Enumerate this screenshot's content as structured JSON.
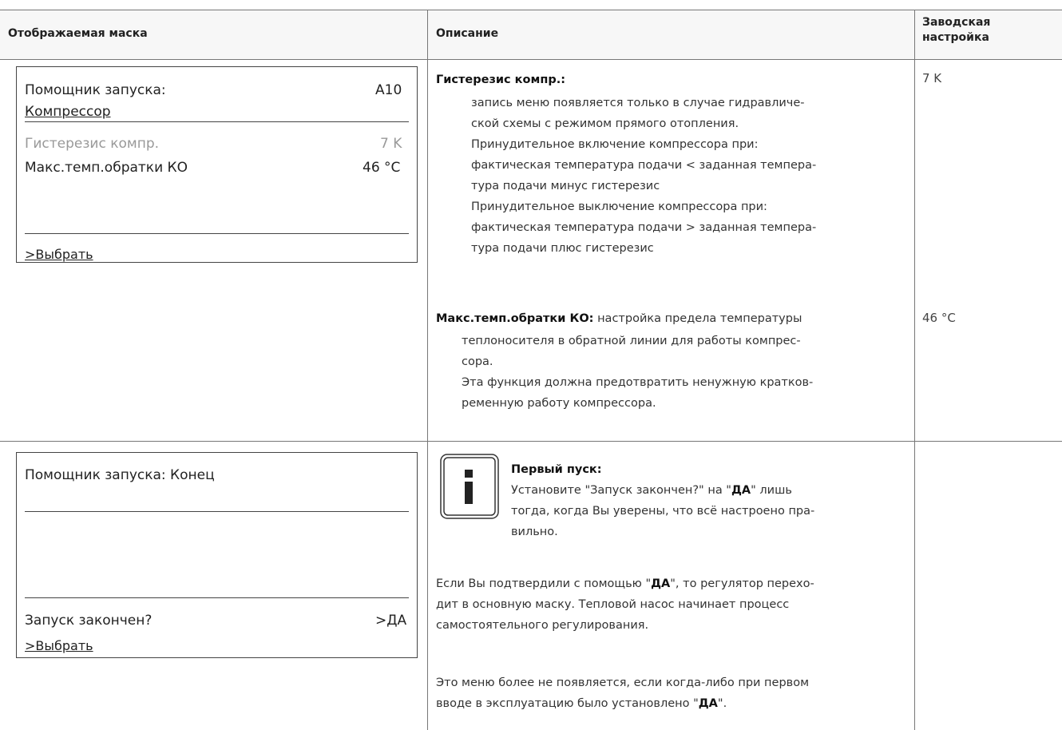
{
  "header": {
    "col1": "Отображаемая маска",
    "col2": "Описание",
    "col3_line1": "Заводская",
    "col3_line2": "настройка"
  },
  "row1": {
    "screen": {
      "title": "Помощник запуска:",
      "code": "A10",
      "subtitle": "Компрессор",
      "item1_label": "Гистерезис компр.",
      "item1_value": "7 K",
      "item2_label": "Макс.темп.обратки КО",
      "item2_value": "46 °C",
      "action": ">Выбрать"
    },
    "desc1": {
      "term": "Гистерезис компр.:",
      "lines": [
        "запись меню появляется только в случае гидравличе-",
        "ской схемы с режимом прямого отопления.",
        "Принудительное включение компрессора при:",
        "фактическая температура подачи < заданная темпера-",
        "тура подачи минус гистерезис",
        "Принудительное выключение компрессора при:",
        "фактическая температура подачи > заданная темпера-",
        "тура подачи плюс гистерезис"
      ]
    },
    "desc2": {
      "term": "Макс.темп.обратки КО:",
      "first_line": " настройка предела температуры",
      "lines": [
        "теплоносителя в обратной линии для работы компрес-",
        "сора.",
        "Эта функция должна предотвратить ненужную кратков-",
        "ременную работу компрессора."
      ]
    },
    "factory1": "7 K",
    "factory2": "46 °C"
  },
  "row2": {
    "screen": {
      "title": "Помощник запуска: Конец",
      "question": "Запуск закончен?",
      "answer": ">ДА",
      "action": ">Выбрать"
    },
    "note": {
      "icon": "info-icon",
      "title": "Первый пуск:",
      "l1_a": "Установите \"Запуск закончен?\" на \"",
      "l1_b": "ДА",
      "l1_c": "\" лишь",
      "l2": "тогда, когда Вы уверены, что всё настроено пра-",
      "l3": "вильно."
    },
    "para1": {
      "l1_a": "Если Вы подтвердили с помощью \"",
      "l1_b": "ДА",
      "l1_c": "\", то регулятор перехо-",
      "l2": "дит в основную маску. Тепловой насос начинает процесс",
      "l3": "самостоятельного регулирования."
    },
    "para2": {
      "l1": "Это меню более не появляется, если когда-либо при первом",
      "l2_a": "вводе в эксплуатацию было установлено \"",
      "l2_b": "ДА",
      "l2_c": "\"."
    }
  }
}
